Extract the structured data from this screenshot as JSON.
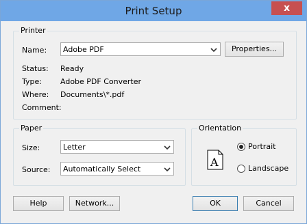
{
  "window": {
    "title": "Print Setup",
    "close_glyph": "x"
  },
  "printer": {
    "group_label": "Printer",
    "name_label": "Name:",
    "name_value": "Adobe PDF",
    "properties_button": "Properties...",
    "status_label": "Status:",
    "status_value": "Ready",
    "type_label": "Type:",
    "type_value": "Adobe PDF Converter",
    "where_label": "Where:",
    "where_value": "Documents\\*.pdf",
    "comment_label": "Comment:",
    "comment_value": ""
  },
  "paper": {
    "group_label": "Paper",
    "size_label": "Size:",
    "size_value": "Letter",
    "source_label": "Source:",
    "source_value": "Automatically Select"
  },
  "orientation": {
    "group_label": "Orientation",
    "portrait_label": "Portrait",
    "landscape_label": "Landscape",
    "selected": "Portrait",
    "page_letter": "A"
  },
  "buttons": {
    "help": "Help",
    "network": "Network...",
    "ok": "OK",
    "cancel": "Cancel"
  },
  "icons": {
    "dropdown": "chevron-down-icon",
    "portrait_page": "page-portrait-icon"
  },
  "colors": {
    "titlebar": "#6fa7e6",
    "close": "#c75050",
    "default_button_border": "#3c7fb1"
  }
}
